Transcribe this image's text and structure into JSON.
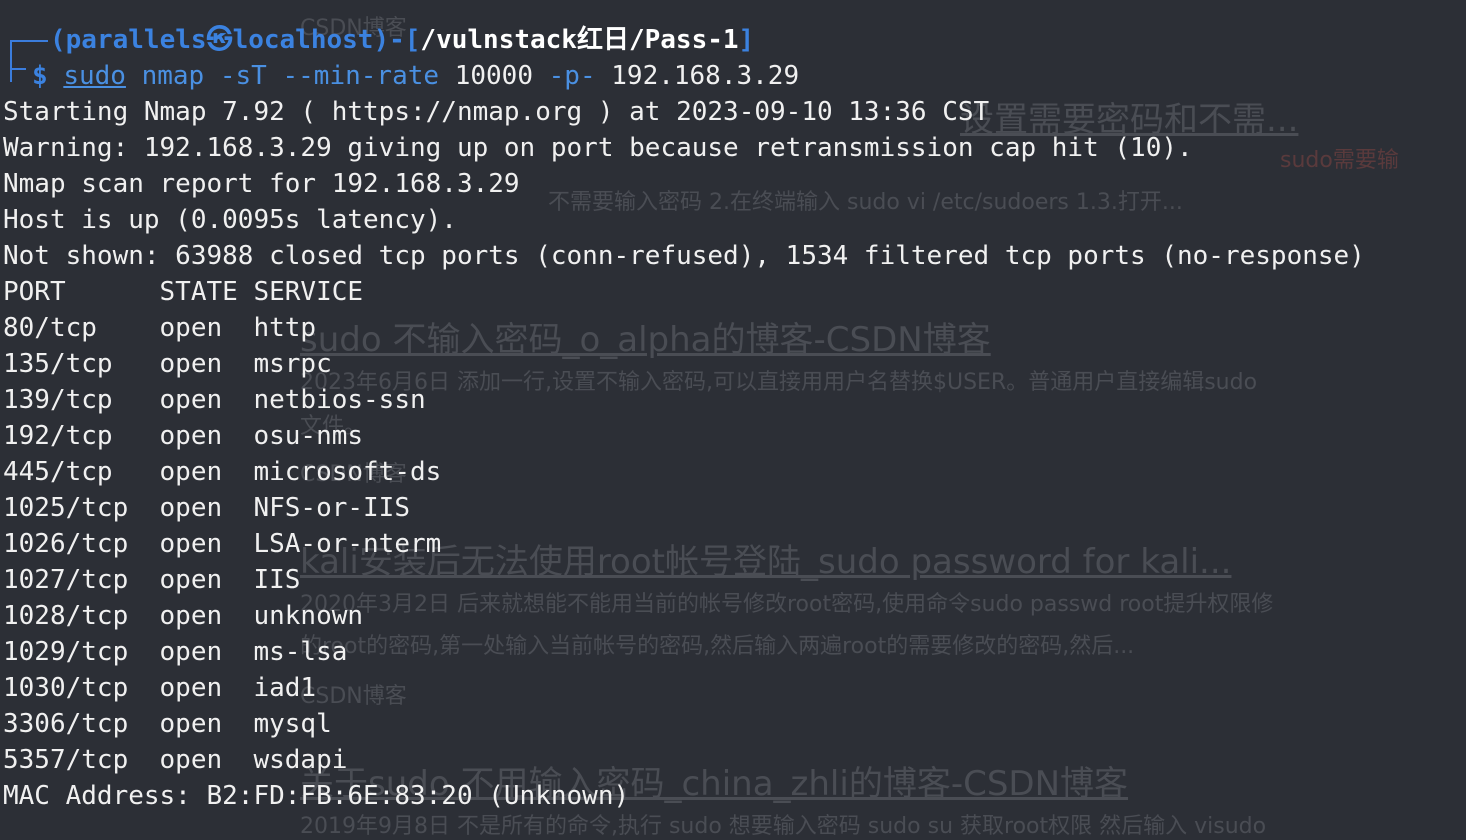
{
  "prompt": {
    "user": "parallels",
    "at_symbol": "㉿",
    "host": "localhost",
    "path": "/vulnstack红日/Pass-1",
    "dollar": "$"
  },
  "command": {
    "sudo": "sudo",
    "nmap": "nmap",
    "flag1": "-sT",
    "flag2": "--min-rate",
    "rate": "10000",
    "flag3": "-p-",
    "target": "192.168.3.29"
  },
  "output": {
    "starting": "Starting Nmap 7.92 ( https://nmap.org ) at 2023-09-10 13:36 CST",
    "warning": "Warning: 192.168.3.29 giving up on port because retransmission cap hit (10).",
    "report": "Nmap scan report for 192.168.3.29",
    "host_up": "Host is up (0.0095s latency).",
    "not_shown": "Not shown: 63988 closed tcp ports (conn-refused), 1534 filtered tcp ports (no-response)",
    "header": "PORT      STATE SERVICE",
    "ports": [
      "80/tcp    open  http",
      "135/tcp   open  msrpc",
      "139/tcp   open  netbios-ssn",
      "192/tcp   open  osu-nms",
      "445/tcp   open  microsoft-ds",
      "1025/tcp  open  NFS-or-IIS",
      "1026/tcp  open  LSA-or-nterm",
      "1027/tcp  open  IIS",
      "1028/tcp  open  unknown",
      "1029/tcp  open  ms-lsa",
      "1030/tcp  open  iad1",
      "3306/tcp  open  mysql",
      "5357/tcp  open  wsdapi"
    ],
    "mac": "MAC Address: B2:FD:FB:6E:83:20 (Unknown)"
  },
  "background": {
    "items": [
      "CSDN博客",
      "设置需要密码和不需...",
      "sudo需要输",
      "不需要输入密码 2.在终端输入 sudo vi /etc/sudoers 1.3.打开...",
      "sudo 不输入密码_o_alpha的博客-CSDN博客",
      "2023年6月6日 添加一行,设置不输入密码,可以直接用用户名替换$USER。普通用户直接编辑sudo",
      "文件。",
      "CSDN博客",
      "kali安装后无法使用root帐号登陆_sudo password for kali...",
      "2020年3月2日 后来就想能不能用当前的帐号修改root密码,使用命令sudo passwd root提升权限修",
      "的root的密码,第一处输入当前帐号的密码,然后输入两遍root的需要修改的密码,然后...",
      "CSDN博客",
      "关于sudo 不用输入密码_china_zhli的博客-CSDN博客",
      "2019年9月8日 不是所有的命令,执行 sudo 想要输入密码 sudo su 获取root权限 然后输入 visudo"
    ]
  },
  "colors": {
    "background": "#2c2f36",
    "prompt_blue": "#3b82e0",
    "text": "#f0f0f0"
  }
}
